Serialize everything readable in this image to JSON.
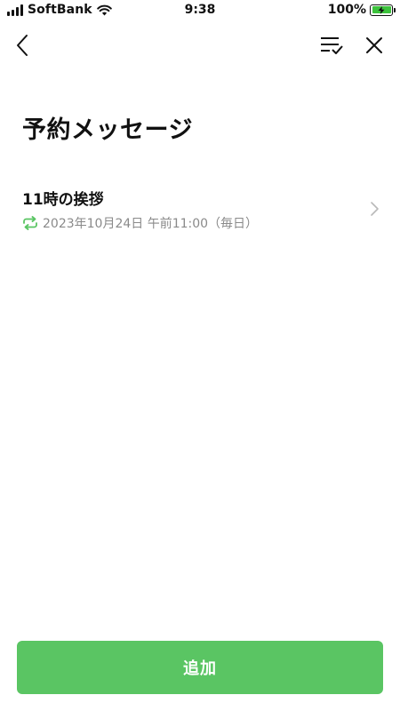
{
  "status_bar": {
    "carrier": "SoftBank",
    "time": "9:38",
    "battery_percent": "100%",
    "battery_level": 1.0,
    "icons": [
      "signal-icon",
      "wifi-icon",
      "battery-charging-icon"
    ]
  },
  "nav": {
    "icons": [
      "chevron-left-icon",
      "checklist-icon",
      "close-icon"
    ]
  },
  "page": {
    "title": "予約メッセージ"
  },
  "reservations": [
    {
      "title": "11時の挨拶",
      "schedule": "2023年10月24日 午前11:00（毎日）",
      "icon": "repeat-icon",
      "repeat_color": "#5ac563"
    }
  ],
  "footer": {
    "add_label": "追加",
    "accent": "#5ac563"
  }
}
